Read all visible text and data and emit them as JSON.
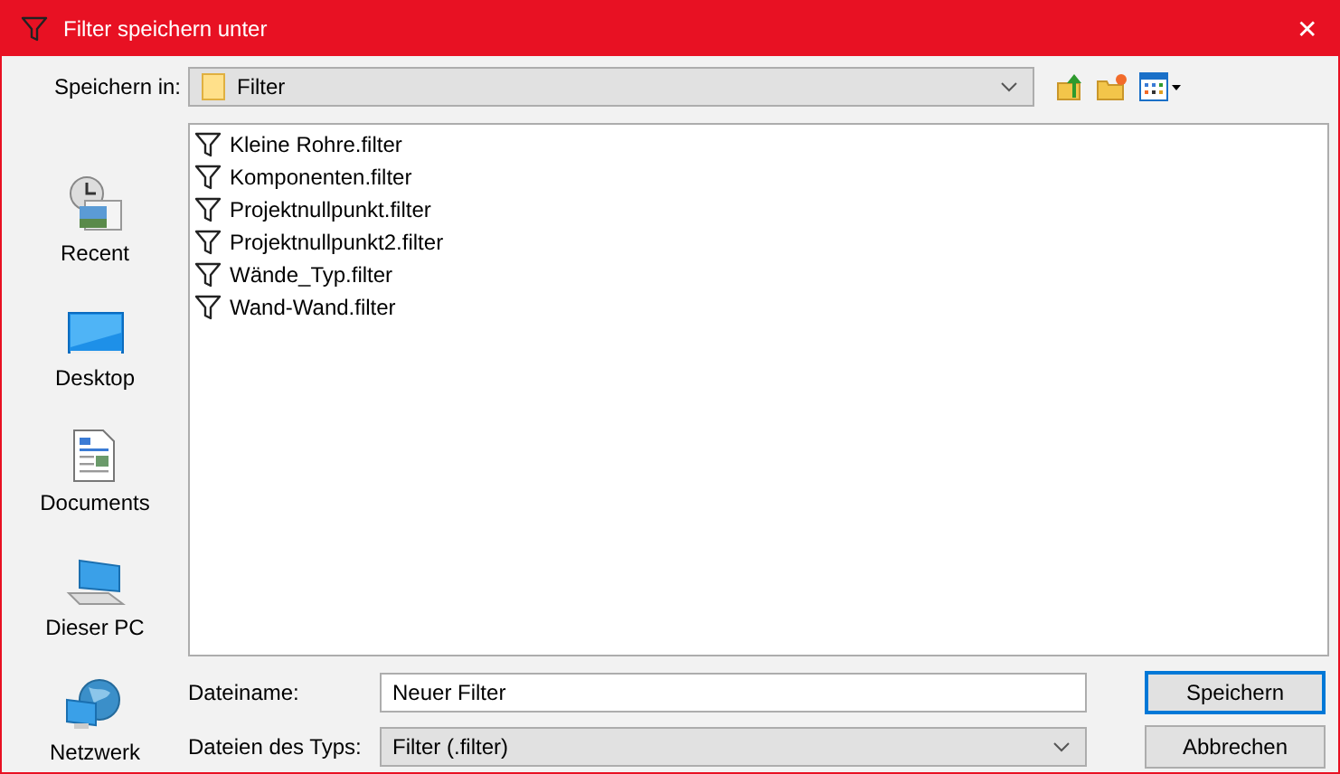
{
  "window": {
    "title": "Filter speichern unter",
    "close": "✕"
  },
  "save_in": {
    "label": "Speichern in:",
    "value": "Filter"
  },
  "places": [
    {
      "kind": "recent",
      "label": "Recent"
    },
    {
      "kind": "desktop",
      "label": "Desktop"
    },
    {
      "kind": "documents",
      "label": "Documents"
    },
    {
      "kind": "pc",
      "label": "Dieser PC"
    },
    {
      "kind": "network",
      "label": "Netzwerk"
    }
  ],
  "files": [
    {
      "name": "Kleine Rohre.filter"
    },
    {
      "name": "Komponenten.filter"
    },
    {
      "name": "Projektnullpunkt.filter"
    },
    {
      "name": "Projektnullpunkt2.filter"
    },
    {
      "name": "Wände_Typ.filter"
    },
    {
      "name": "Wand-Wand.filter"
    }
  ],
  "file_name": {
    "label": "Dateiname:",
    "value": "Neuer Filter"
  },
  "file_type": {
    "label": "Dateien des Typs:",
    "value": "Filter (.filter)"
  },
  "buttons": [
    {
      "label": "Speichern",
      "default": true
    },
    {
      "label": "Abbrechen",
      "default": false
    }
  ]
}
